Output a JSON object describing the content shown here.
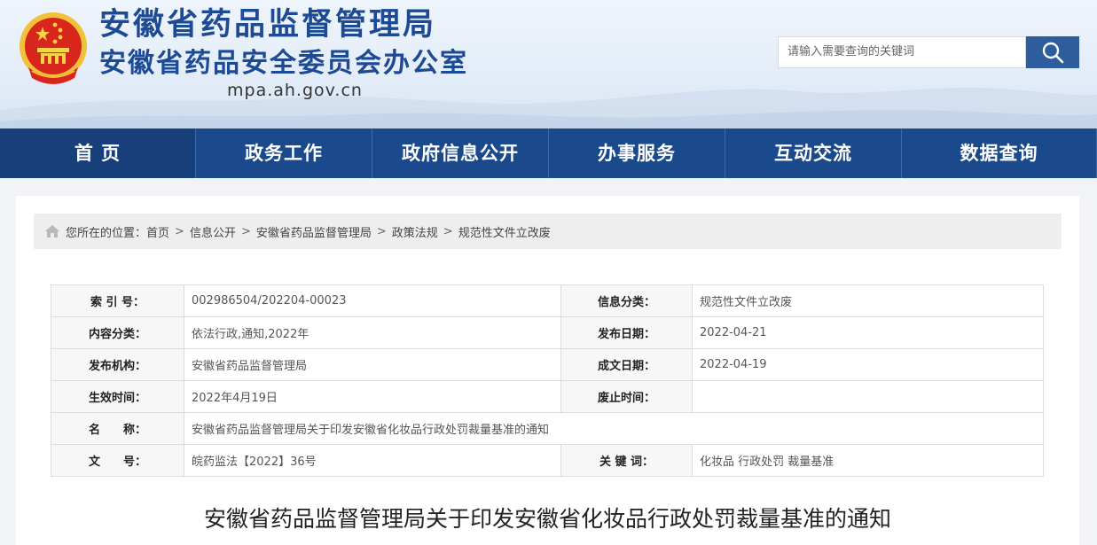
{
  "header": {
    "title": "安徽省药品监督管理局",
    "subtitle": "安徽省药品安全委员会办公室",
    "domain": "mpa.ah.gov.cn",
    "search_placeholder": "请输入需要查询的关键词"
  },
  "nav": {
    "items": [
      {
        "label": "首 页"
      },
      {
        "label": "政务工作"
      },
      {
        "label": "政府信息公开"
      },
      {
        "label": "办事服务"
      },
      {
        "label": "互动交流"
      },
      {
        "label": "数据查询"
      }
    ]
  },
  "breadcrumb": {
    "prefix": "您所在的位置：",
    "separator": ">",
    "items": [
      {
        "label": "首页"
      },
      {
        "label": "信息公开"
      },
      {
        "label": "安徽省药品监督管理局"
      },
      {
        "label": "政策法规"
      },
      {
        "label": "规范性文件立改废"
      }
    ]
  },
  "meta": {
    "index_label": "索 引 号：",
    "index_value": "002986504/202204-00023",
    "info_category_label": "信息分类：",
    "info_category_value": "规范性文件立改废",
    "content_category_label": "内容分类：",
    "content_category_value": "依法行政,通知,2022年",
    "publish_date_label": "发布日期：",
    "publish_date_value": "2022-04-21",
    "publisher_label": "发布机构：",
    "publisher_value": "安徽省药品监督管理局",
    "written_date_label": "成文日期：",
    "written_date_value": "2022-04-19",
    "effective_label": "生效时间：",
    "effective_value": "2022年4月19日",
    "repeal_label": "废止时间：",
    "repeal_value": "",
    "name_label": "名　　称：",
    "name_value": "安徽省药品监督管理局关于印发安徽省化妆品行政处罚裁量基准的通知",
    "doc_no_label": "文　　号：",
    "doc_no_value": "皖药监法【2022】36号",
    "keywords_label": "关 键 词：",
    "keywords_value": "化妆品 行政处罚 裁量基准"
  },
  "document": {
    "title": "安徽省药品监督管理局关于印发安徽省化妆品行政处罚裁量基准的通知"
  },
  "colors": {
    "brand_blue": "#1d4a94",
    "nav_bg": "#1b4a8c",
    "search_button": "#2d5d9c"
  },
  "icons": {
    "emblem": "national-emblem-icon",
    "search": "search-icon",
    "home": "home-icon"
  }
}
